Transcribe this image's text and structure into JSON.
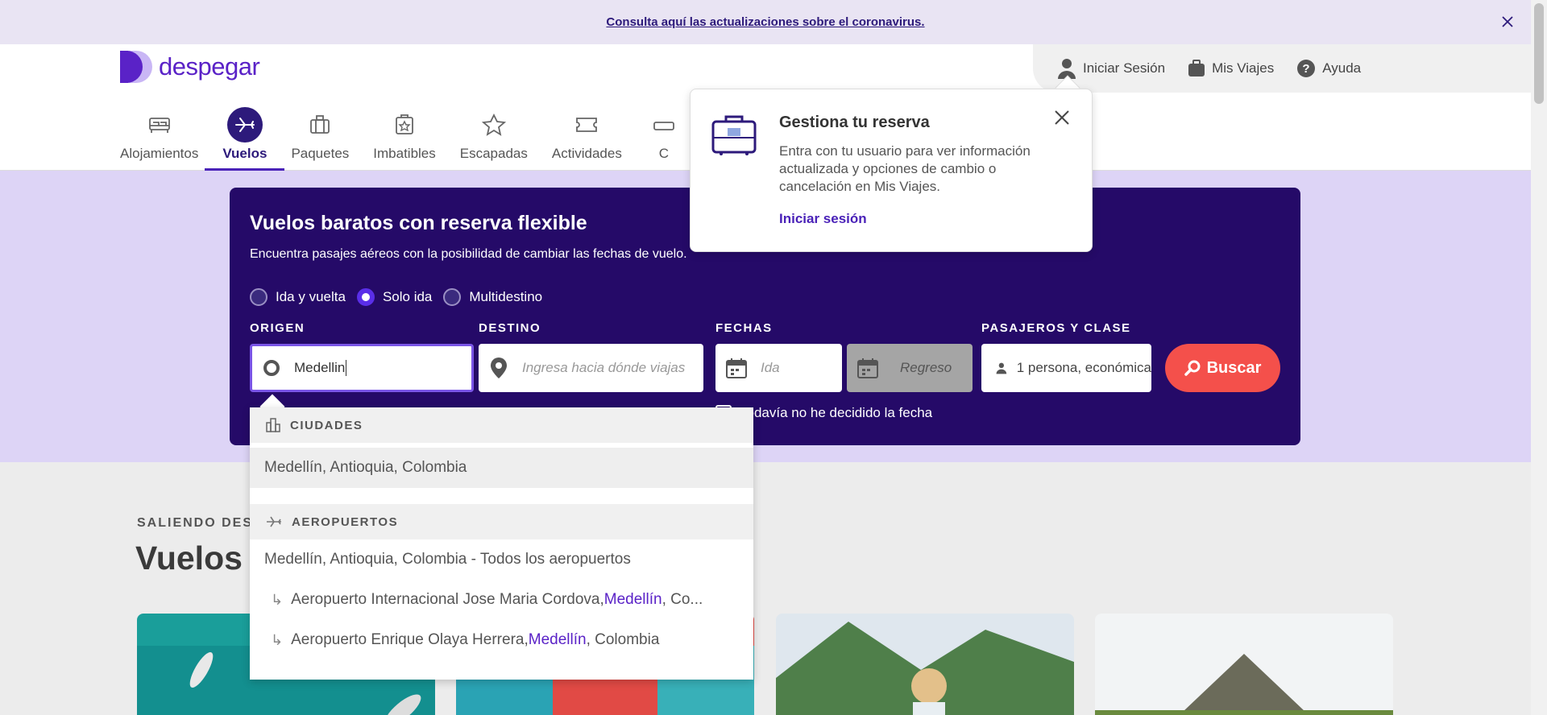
{
  "notice": {
    "text": "Consulta aquí las actualizaciones sobre el coronavirus."
  },
  "brand": {
    "name": "despegar",
    "color": "#5a22c7"
  },
  "user_nav": [
    {
      "label": "Iniciar Sesión",
      "icon": "user-icon"
    },
    {
      "label": "Mis Viajes",
      "icon": "suitcase-icon"
    },
    {
      "label": "Ayuda",
      "icon": "help-icon"
    }
  ],
  "products": [
    {
      "label": "Alojamientos",
      "icon": "bed-icon"
    },
    {
      "label": "Vuelos",
      "icon": "plane-icon",
      "active": true
    },
    {
      "label": "Paquetes",
      "icon": "luggage-icon"
    },
    {
      "label": "Imbatibles",
      "icon": "badge-icon"
    },
    {
      "label": "Escapadas",
      "icon": "star-icon"
    },
    {
      "label": "Actividades",
      "icon": "ticket-icon"
    },
    {
      "label": "C",
      "icon": "car-icon"
    }
  ],
  "popover": {
    "title": "Gestiona tu reserva",
    "body": "Entra con tu usuario para ver información actualizada y opciones de cambio o cancelación en Mis Viajes.",
    "link": "Iniciar sesión"
  },
  "hero": {
    "title": "Vuelos baratos con reserva flexible",
    "subtitle": "Encuentra pasajes aéreos con la posibilidad de cambiar las fechas de vuelo."
  },
  "trip_types": [
    {
      "label": "Ida y vuelta",
      "selected": false
    },
    {
      "label": "Solo ida",
      "selected": true
    },
    {
      "label": "Multidestino",
      "selected": false
    }
  ],
  "search": {
    "origin_label": "ORIGEN",
    "origin_value": "Medellin",
    "dest_label": "DESTINO",
    "dest_placeholder": "Ingresa hacia dónde viajas",
    "dates_label": "FECHAS",
    "ida_placeholder": "Ida",
    "regreso_placeholder": "Regreso",
    "pax_label": "PASAJEROS Y CLASE",
    "pax_value": "1 persona, económica",
    "button": "Buscar",
    "undecided": "Todavía no he decidido la fecha"
  },
  "dropdown": {
    "cities_header": "CIUDADES",
    "cities": [
      "Medellín, Antioquia, Colombia"
    ],
    "airports_header": "AEROPUERTOS",
    "airports_all": "Medellín, Antioquia, Colombia - Todos los aeropuertos",
    "airports": [
      {
        "pre": "Aeropuerto Internacional Jose Maria Cordova, ",
        "em": "Medellín",
        "post": ", Co..."
      },
      {
        "pre": "Aeropuerto Enrique Olaya Herrera, ",
        "em": "Medellín",
        "post": ", Colombia"
      }
    ]
  },
  "section": {
    "eyebrow": "SALIENDO DESDE",
    "title": "Vuelos baratos"
  }
}
